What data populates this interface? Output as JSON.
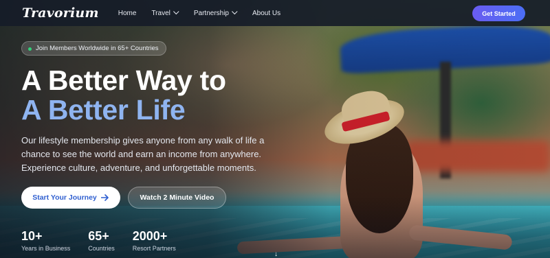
{
  "navbar": {
    "logo": "Travorium",
    "items": [
      {
        "label": "Home",
        "has_dropdown": false
      },
      {
        "label": "Travel",
        "has_dropdown": true
      },
      {
        "label": "Partnership",
        "has_dropdown": true
      },
      {
        "label": "About Us",
        "has_dropdown": false
      }
    ],
    "cta_label": "Get Started"
  },
  "hero": {
    "badge": "Join Members Worldwide in 65+ Countries",
    "title_line1": "A Better Way to",
    "title_line2": "A Better Life",
    "description": "Our lifestyle membership gives anyone from any walk of life a chance to see the world and earn an income from anywhere. Experience culture, adventure, and unforgettable moments.",
    "primary_button": "Start Your Journey",
    "primary_button_icon": "arrow-right-icon",
    "secondary_button": "Watch 2 Minute Video"
  },
  "stats": [
    {
      "value": "10+",
      "label": "Years in Business"
    },
    {
      "value": "65+",
      "label": "Countries"
    },
    {
      "value": "2000+",
      "label": "Resort Partners"
    }
  ],
  "colors": {
    "accent_gradient_start": "#6a5cf0",
    "accent_gradient_end": "#4b6ef5",
    "title_highlight": "#8fb4f0",
    "badge_dot": "#33d17a"
  }
}
